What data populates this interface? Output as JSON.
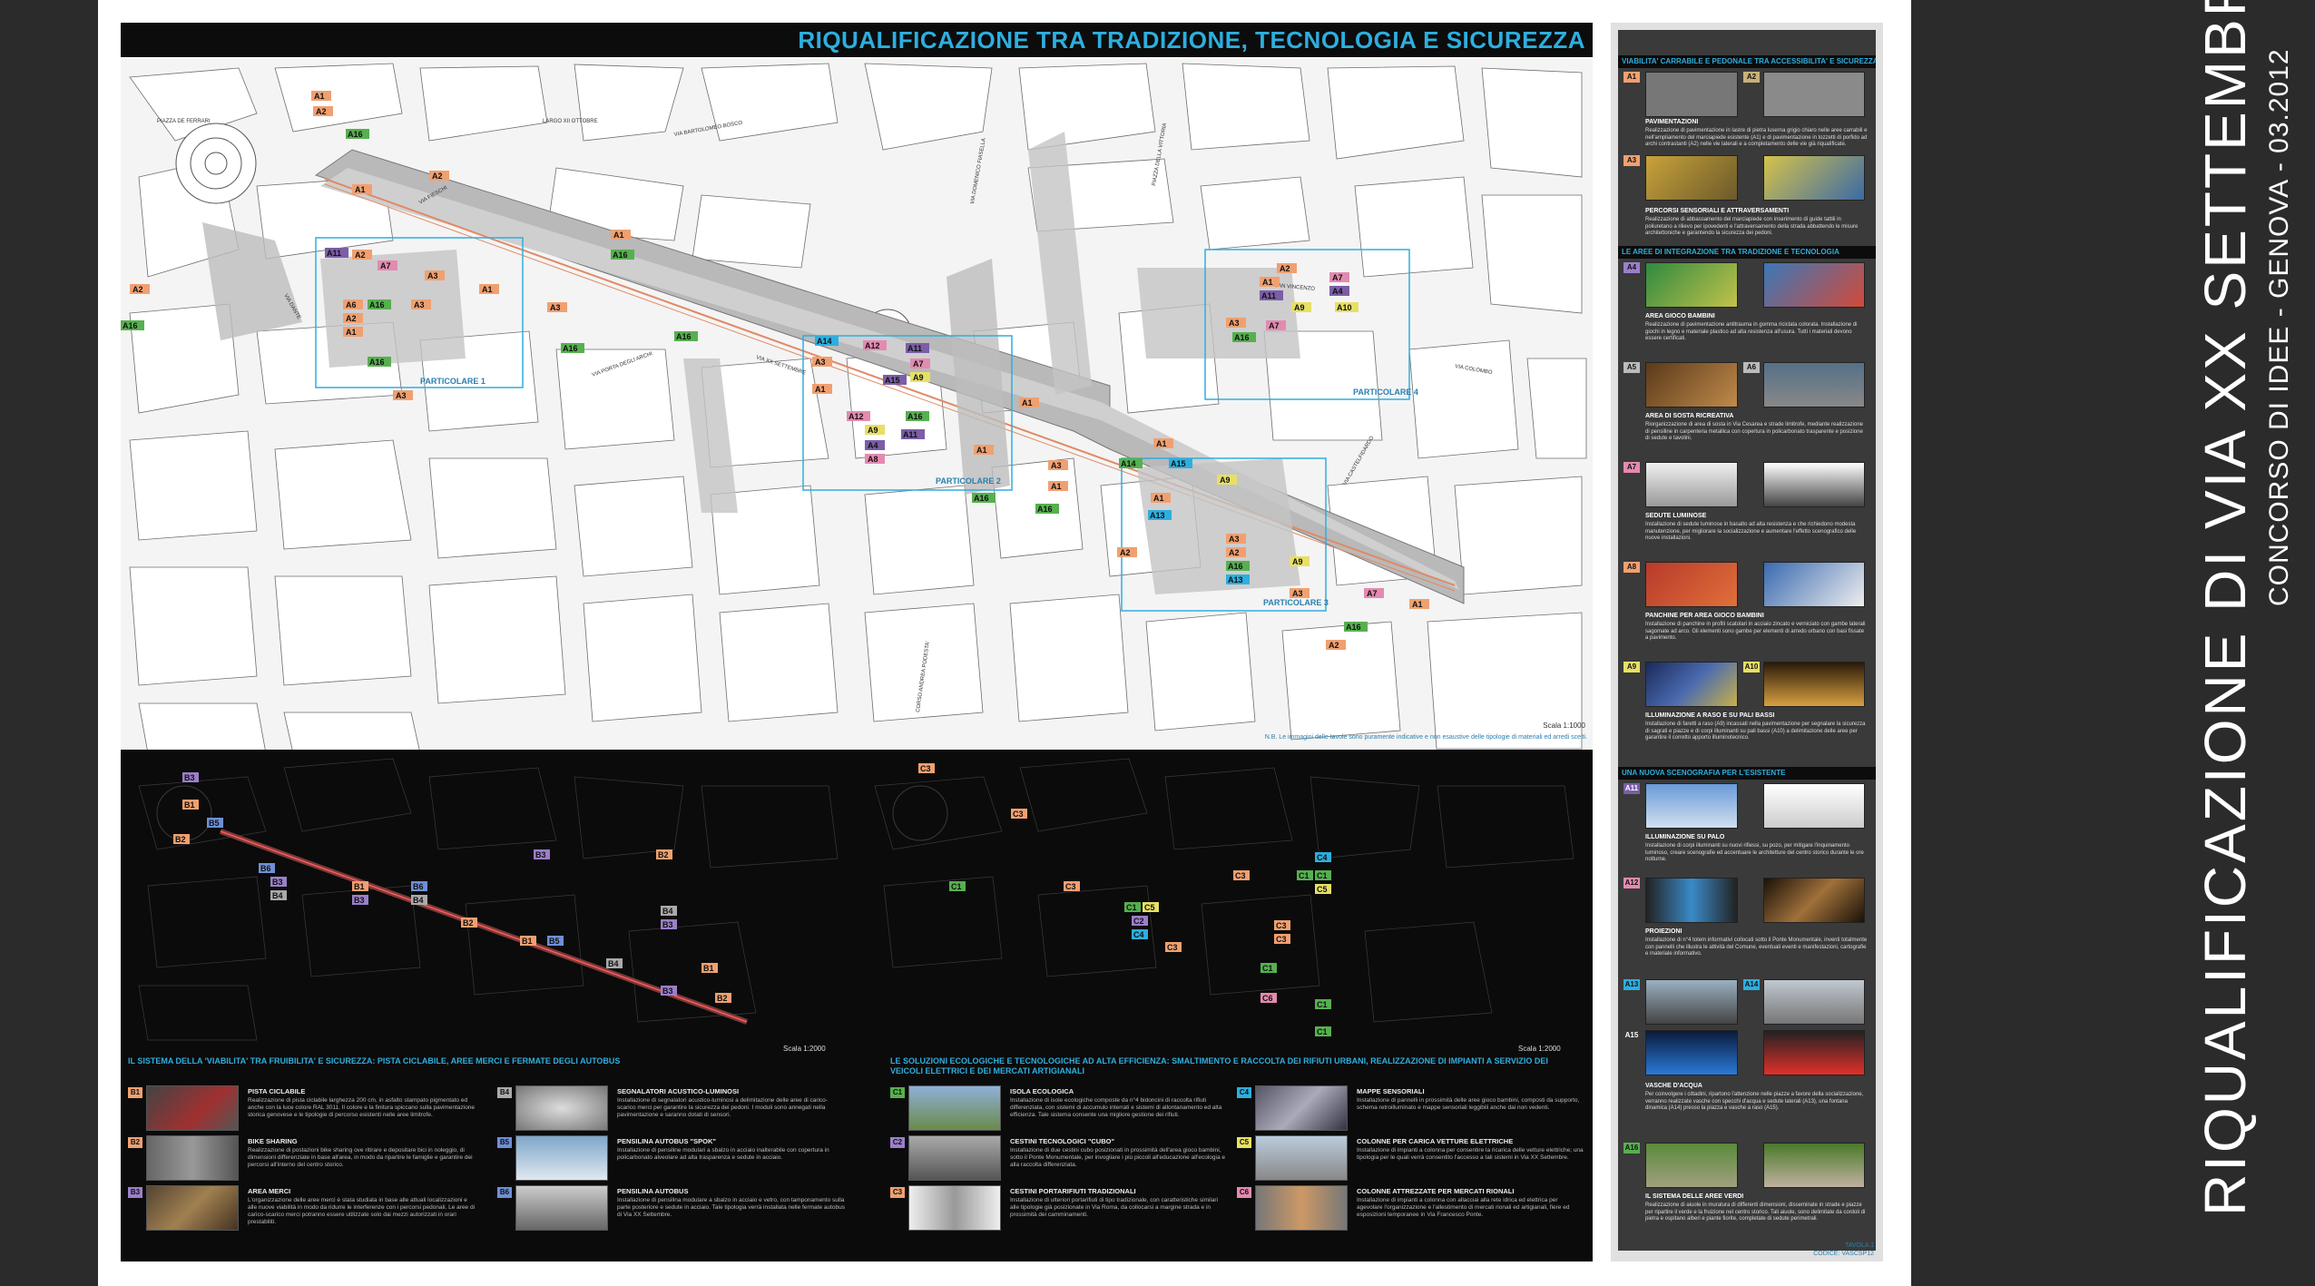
{
  "vertical_title": "RIQUALIFICAZIONE DI VIA XX SETTEMBRE",
  "vertical_subtitle": "CONCORSO DI IDEE - GENOVA - 03.2012",
  "map_title": "RIQUALIFICAZIONE TRA TRADIZIONE, TECNOLOGIA E SICUREZZA",
  "map_scale": "Scala 1:1000",
  "map_note": "N.B. Le immagini delle tavole sono puramente indicative e non esaustive delle tipologie di materiali ed arredi scelti.",
  "particolari": [
    "PARTICOLARE 1",
    "PARTICOLARE 2",
    "PARTICOLARE 3",
    "PARTICOLARE 4"
  ],
  "colors": {
    "orange": "#f0a070",
    "purple": "#7b5ea7",
    "green": "#56b04f",
    "cyan": "#2eaede",
    "yellow": "#e7e065",
    "pink": "#e48ab0"
  },
  "dark_scale_left": "Scala 1:2000",
  "dark_scale_right": "Scala 1:2000",
  "sec_b_title": "IL SISTEMA DELLA 'VIABILITA' TRA FRUIBILITA' E SICUREZZA: PISTA CICLABILE, AREE MERCI E FERMATE DEGLI AUTOBUS",
  "sec_c_title": "LE SOLUZIONI ECOLOGICHE E TECNOLOGICHE AD ALTA EFFICIENZA: SMALTIMENTO E RACCOLTA DEI RIFIUTI URBANI, REALIZZAZIONE DI IMPIANTI A SERVIZIO DEI VEICOLI ELETTRICI E DEI MERCATI ARTIGIANALI",
  "b_items": [
    {
      "code": "B1",
      "title": "PISTA CICLABILE",
      "desc": "Realizzazione di pista ciclabile larghezza 200 cm, in asfalto stampato pigmentato ed anche con la luce colore RAL 3011. Il colore e la finitura spiccano sulla pavimentazione storica genovese e le tipologie di percorso esistenti nelle aree limitrofe."
    },
    {
      "code": "B2",
      "title": "BIKE SHARING",
      "desc": "Realizzazione di postazioni bike sharing ove ritirare e depositare bici in noleggio, di dimensioni differenziate in base all'area, in modo da ripartire le famiglie e garantire dei percorsi all'interno del centro storico."
    },
    {
      "code": "B3",
      "title": "AREA MERCI",
      "desc": "L'organizzazione delle aree merci è stata studiata in base alle attuali localizzazioni e alle nuove viabilità in modo da ridurre le interferenze con i percorsi pedonali. Le aree di carico-scarico merci potranno essere utilizzate solo dai mezzi autorizzati in orari prestabiliti."
    },
    {
      "code": "B4",
      "title": "SEGNALATORI ACUSTICO-LUMINOSI",
      "desc": "Installazione di segnalatori acustico-luminosi a delimitazione delle aree di carico-scarico merci per garantire la sicurezza dei pedoni. I moduli sono annegati nella pavimentazione e saranno dotati di sensori."
    },
    {
      "code": "B5",
      "title": "PENSILINA AUTOBUS \"SPOK\"",
      "desc": "Installazione di pensiline modulari a sbalzo in acciaio inalterabile con copertura in policarbonato alveolare ad alta trasparenza e sedute in acciaio."
    },
    {
      "code": "B6",
      "title": "PENSILINA AUTOBUS",
      "desc": "Installazione di pensilina modulare a sbalzo in acciaio e vetro, con tamponamento sulla parte posteriore e sedute in acciaio. Tale tipologia verrà installata nelle fermate autobus di Via XX Settembre."
    }
  ],
  "c_items": [
    {
      "code": "C1",
      "title": "ISOLA ECOLOGICA",
      "desc": "Installazione di isole ecologiche composte da n°4 bidoncini di raccolta rifiuti differenziata, con sistemi di accumulo interrati e sistemi di allontanamento ed alta efficienza. Tale sistema consente una migliore gestione dei rifiuti."
    },
    {
      "code": "C2",
      "title": "CESTINI TECNOLOGICI \"CUBO\"",
      "desc": "Installazione di due cestini cubo posizionati in prossimità dell'area gioco bambini, sotto il Ponte Monumentale, per invogliare i più piccoli all'educazione all'ecologia e alla raccolta differenziata."
    },
    {
      "code": "C3",
      "title": "CESTINI PORTARIFIUTI TRADIZIONALI",
      "desc": "Installazione di ulteriori portarifiuti di tipo tradizionale, con caratteristiche similari alle tipologie già posizionate in Via Roma, da collocarsi a margine strada e in prossimità dei camminamenti."
    },
    {
      "code": "C4",
      "title": "MAPPE SENSORIALI",
      "desc": "Installazione di pannelli in prossimità delle aree gioco bambini, composti da supporto, schema retroilluminato e mappe sensoriali leggibili anche dai non vedenti."
    },
    {
      "code": "C5",
      "title": "COLONNE PER CARICA VETTURE ELETTRICHE",
      "desc": "Installazione di impianti a colonna per consentire la ricarica delle vetture elettriche; una tipologia per le quali verrà consentito l'accesso a tali sistemi in Via XX Settembre."
    },
    {
      "code": "C6",
      "title": "COLONNE ATTREZZATE PER MERCATI RIONALI",
      "desc": "Installazione di impianti a colonna con allacciai alla rete idrica ed elettrica per agevolare l'organizzazione e l'allestimento di mercati rionali ed artigianali, fiere ed esposizioni temporanee in Via Francesco Ponte."
    }
  ],
  "right_sections": [
    {
      "title": "VIABILITA' CARRABILE E PEDONALE TRA ACCESSIBILITA' E SICUREZZA"
    },
    {
      "title": "LE AREE DI INTEGRAZIONE TRA TRADIZIONE E TECNOLOGIA"
    },
    {
      "title": "UNA NUOVA SCENOGRAFIA PER L'ESISTENTE"
    }
  ],
  "right_items": [
    {
      "codes": [
        "A1",
        "A2"
      ],
      "title": "PAVIMENTAZIONI",
      "desc": "Realizzazione di pavimentazione in lastre di pietra luserna grigio chiaro nelle aree carrabili e nell'ampliamento del marciapiede esistente (A1) e di pavimentazione in tozzetti di porfido ad archi contrastanti (A2) nelle vie laterali e a completamento delle vie già riqualificate."
    },
    {
      "codes": [
        "A3"
      ],
      "title": "PERCORSI SENSORIALI E ATTRAVERSAMENTI",
      "desc": "Realizzazione di abbassamento del marciapiede con inserimento di guide tattili in poliuretano a rilievo per ipovedenti e l'attraversamento della strada abbattendo le misure architettoniche e garantendo la sicurezza dei pedoni."
    },
    {
      "codes": [
        "A4"
      ],
      "title": "AREA GIOCO BAMBINI",
      "desc": "Realizzazione di pavimentazione antitrauma in gomma riciclata colorata. Installazione di giochi in legno e materiale plastico ad alta resistenza all'usura. Tutti i materiali devono essere certificati."
    },
    {
      "codes": [
        "A5",
        "A6"
      ],
      "title": "AREA DI SOSTA RICREATIVA",
      "desc": "Riorganizzazione di area di sosta in Via Cesarea e strade limitrofe, mediante realizzazione di pensiline in carpenteria metallica con copertura in policarbonato trasparente e posizione di sedute e tavolini."
    },
    {
      "codes": [
        "A7"
      ],
      "title": "SEDUTE LUMINOSE",
      "desc": "Installazione di sedute luminose in basalto ad alta resistenza e che richiedono modesta manutenzione, per migliorare la socializzazione e aumentare l'effetto scenografico delle nuove installazioni."
    },
    {
      "codes": [
        "A8"
      ],
      "title": "PANCHINE PER AREA GIOCO BAMBINI",
      "desc": "Installazione di panchine in profili scatolari in acciaio zincato e verniciato con gambe laterali sagomate ad arco. Gli elementi sono gambe per elementi di arredo urbano con basi fissate a pavimento."
    },
    {
      "codes": [
        "A9",
        "A10"
      ],
      "title": "ILLUMINAZIONE A RASO E SU PALI BASSI",
      "desc": "Installazione di faretti a raso (A9) incassati nella pavimentazione per segnalare la sicurezza di sagrati e piazze e di corpi illuminanti su pali bassi (A10) a delimitazione delle aree per garantire il corretto apporto illuminotecnico."
    },
    {
      "codes": [
        "A11"
      ],
      "title": "ILLUMINAZIONE SU PALO",
      "desc": "Installazione di corpi illuminanti su nuovi rifiessi, su pozo, per mitigare l'inquinamento luminoso, creare scenografie ed accentuare le architetture del centro storico durante le ore notturne."
    },
    {
      "codes": [
        "A12"
      ],
      "title": "PROIEZIONI",
      "desc": "Installazione di n°4 totem informativi collocati sotto il Ponte Monumentale, inventi totalmente con pannelli che illustra le attività del Comune, eventuali eventi e manifestazioni, cartografie e materiale informativo."
    },
    {
      "codes": [
        "A13",
        "A14"
      ],
      "title": "",
      "desc": ""
    },
    {
      "codes": [
        "A15"
      ],
      "title": "VASCHE D'ACQUA",
      "desc": "Per coinvolgere i cittadini, ripartono l'attenzione nelle piazze a favore della socializzazione, verranno realizzate vasche con specchi d'acqua e sedute laterali (A13), una fontana dinamica (A14) presso la piazza e vasche a raso (A15)."
    },
    {
      "codes": [
        "A16"
      ],
      "title": "IL SISTEMA DELLE AREE VERDI",
      "desc": "Realizzazione di aiuole in muratura di differenti dimensioni, disseminate in strade e piazze per ripartire il verde e la fruizione nel centro storico. Tali aiuole, sono delimitate da cordoli di pietra e ospitano alberi e piante fiorite, completate di sedute perimetrali."
    }
  ],
  "footer_tavola": "TAVOLA 1",
  "footer_codice": "CODICE: VASCSP12",
  "map_streets": [
    "PIAZZA DE FERRARI",
    "VIA XX SETTEMBRE",
    "VIA SAN VINCENZO",
    "VIA FIESCHI",
    "VIA PORTA DEGLI ARCHI",
    "VIA DANTE",
    "CORSO ANDREA PODESTA'",
    "PIAZZA DELLA VITTORIA",
    "VIA COLOMBO",
    "VIA CASTELFIDARDO",
    "VIA DOMENICO FIASELLA",
    "LARGO XII OTTOBRE",
    "VIA BARTOLOMEO BOSCO"
  ]
}
